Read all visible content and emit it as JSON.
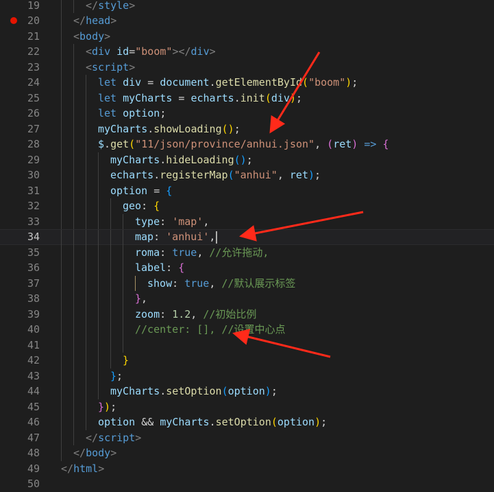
{
  "colors": {
    "background": "#1e1e1e",
    "line_number": "#858585",
    "tag": "#569cd6",
    "bracket_tag": "#808080",
    "attr": "#9cdcfe",
    "string": "#ce9178",
    "keyword": "#569cd6",
    "variable": "#9cdcfe",
    "function": "#dcdcaa",
    "number": "#b5cea8",
    "comment": "#6a9955",
    "punct": "#d4d4d4",
    "bracket1": "#ffd700",
    "bracket2": "#da70d6",
    "bracket3": "#179fff",
    "breakpoint": "#e51400",
    "arrow": "#ff2a1a"
  },
  "editor": {
    "current_line": 34,
    "breakpoint_line": 20,
    "lines": [
      {
        "n": 19,
        "indent": 1,
        "tokens": [
          [
            "</",
            "bracket_tag"
          ],
          [
            "style",
            "tag"
          ],
          [
            ">",
            "bracket_tag"
          ]
        ]
      },
      {
        "n": 20,
        "indent": 0,
        "tokens": [
          [
            "</",
            "bracket_tag"
          ],
          [
            "head",
            "tag"
          ],
          [
            ">",
            "bracket_tag"
          ]
        ]
      },
      {
        "n": 21,
        "indent": 0,
        "tokens": [
          [
            "<",
            "bracket_tag"
          ],
          [
            "body",
            "tag"
          ],
          [
            ">",
            "bracket_tag"
          ]
        ]
      },
      {
        "n": 22,
        "indent": 1,
        "tokens": [
          [
            "<",
            "bracket_tag"
          ],
          [
            "div",
            "tag"
          ],
          [
            " ",
            "punct"
          ],
          [
            "id",
            "attr"
          ],
          [
            "=",
            "punct"
          ],
          [
            "\"boom\"",
            "string"
          ],
          [
            "></",
            "bracket_tag"
          ],
          [
            "div",
            "tag"
          ],
          [
            ">",
            "bracket_tag"
          ]
        ]
      },
      {
        "n": 23,
        "indent": 1,
        "tokens": [
          [
            "<",
            "bracket_tag"
          ],
          [
            "script",
            "tag"
          ],
          [
            ">",
            "bracket_tag"
          ]
        ]
      },
      {
        "n": 24,
        "indent": 2,
        "tokens": [
          [
            "let",
            "keyword"
          ],
          [
            " ",
            "punct"
          ],
          [
            "div",
            "variable"
          ],
          [
            " = ",
            "punct"
          ],
          [
            "document",
            "variable"
          ],
          [
            ".",
            "punct"
          ],
          [
            "getElementById",
            "function"
          ],
          [
            "(",
            "bracket1"
          ],
          [
            "\"boom\"",
            "string"
          ],
          [
            ")",
            "bracket1"
          ],
          [
            ";",
            "punct"
          ]
        ]
      },
      {
        "n": 25,
        "indent": 2,
        "tokens": [
          [
            "let",
            "keyword"
          ],
          [
            " ",
            "punct"
          ],
          [
            "myCharts",
            "variable"
          ],
          [
            " = ",
            "punct"
          ],
          [
            "echarts",
            "variable"
          ],
          [
            ".",
            "punct"
          ],
          [
            "init",
            "function"
          ],
          [
            "(",
            "bracket1"
          ],
          [
            "div",
            "variable"
          ],
          [
            ")",
            "bracket1"
          ],
          [
            ";",
            "punct"
          ]
        ]
      },
      {
        "n": 26,
        "indent": 2,
        "tokens": [
          [
            "let",
            "keyword"
          ],
          [
            " ",
            "punct"
          ],
          [
            "option",
            "variable"
          ],
          [
            ";",
            "punct"
          ]
        ]
      },
      {
        "n": 27,
        "indent": 2,
        "tokens": [
          [
            "myCharts",
            "variable"
          ],
          [
            ".",
            "punct"
          ],
          [
            "showLoading",
            "function"
          ],
          [
            "()",
            "bracket1"
          ],
          [
            ";",
            "punct"
          ]
        ]
      },
      {
        "n": 28,
        "indent": 2,
        "tokens": [
          [
            "$",
            "variable"
          ],
          [
            ".",
            "punct"
          ],
          [
            "get",
            "function"
          ],
          [
            "(",
            "bracket1"
          ],
          [
            "\"11/json/province/anhui.json\"",
            "string"
          ],
          [
            ", ",
            "punct"
          ],
          [
            "(",
            "bracket2"
          ],
          [
            "ret",
            "variable"
          ],
          [
            ")",
            "bracket2"
          ],
          [
            " ",
            "punct"
          ],
          [
            "=>",
            "keyword"
          ],
          [
            " ",
            "punct"
          ],
          [
            "{",
            "bracket2"
          ]
        ]
      },
      {
        "n": 29,
        "indent": 3,
        "tokens": [
          [
            "myCharts",
            "variable"
          ],
          [
            ".",
            "punct"
          ],
          [
            "hideLoading",
            "function"
          ],
          [
            "()",
            "bracket3"
          ],
          [
            ";",
            "punct"
          ]
        ]
      },
      {
        "n": 30,
        "indent": 3,
        "tokens": [
          [
            "echarts",
            "variable"
          ],
          [
            ".",
            "punct"
          ],
          [
            "registerMap",
            "function"
          ],
          [
            "(",
            "bracket3"
          ],
          [
            "\"anhui\"",
            "string"
          ],
          [
            ", ",
            "punct"
          ],
          [
            "ret",
            "variable"
          ],
          [
            ")",
            "bracket3"
          ],
          [
            ";",
            "punct"
          ]
        ]
      },
      {
        "n": 31,
        "indent": 3,
        "tokens": [
          [
            "option",
            "variable"
          ],
          [
            " = ",
            "punct"
          ],
          [
            "{",
            "bracket3"
          ]
        ]
      },
      {
        "n": 32,
        "indent": 4,
        "tokens": [
          [
            "geo",
            "variable"
          ],
          [
            ": ",
            "punct"
          ],
          [
            "{",
            "bracket1"
          ]
        ]
      },
      {
        "n": 33,
        "indent": 5,
        "tokens": [
          [
            "type",
            "variable"
          ],
          [
            ": ",
            "punct"
          ],
          [
            "'map'",
            "string"
          ],
          [
            ",",
            "punct"
          ]
        ]
      },
      {
        "n": 34,
        "indent": 5,
        "tokens": [
          [
            "map",
            "variable"
          ],
          [
            ": ",
            "punct"
          ],
          [
            "'anhui'",
            "string"
          ],
          [
            ",",
            "punct"
          ]
        ]
      },
      {
        "n": 35,
        "indent": 5,
        "tokens": [
          [
            "roma",
            "variable"
          ],
          [
            ": ",
            "punct"
          ],
          [
            "true",
            "keyword"
          ],
          [
            ", ",
            "punct"
          ],
          [
            "//允许拖动,",
            "comment"
          ]
        ]
      },
      {
        "n": 36,
        "indent": 5,
        "tokens": [
          [
            "label",
            "variable"
          ],
          [
            ": ",
            "punct"
          ],
          [
            "{",
            "bracket2"
          ]
        ]
      },
      {
        "n": 37,
        "indent": 6,
        "tokens": [
          [
            "show",
            "variable"
          ],
          [
            ": ",
            "punct"
          ],
          [
            "true",
            "keyword"
          ],
          [
            ", ",
            "punct"
          ],
          [
            "//默认展示标签",
            "comment"
          ]
        ]
      },
      {
        "n": 38,
        "indent": 5,
        "tokens": [
          [
            "}",
            "bracket2"
          ],
          [
            ",",
            "punct"
          ]
        ]
      },
      {
        "n": 39,
        "indent": 5,
        "tokens": [
          [
            "zoom",
            "variable"
          ],
          [
            ": ",
            "punct"
          ],
          [
            "1.2",
            "number"
          ],
          [
            ", ",
            "punct"
          ],
          [
            "//初始比例",
            "comment"
          ]
        ]
      },
      {
        "n": 40,
        "indent": 5,
        "tokens": [
          [
            "//center: [], //设置中心点",
            "comment"
          ]
        ]
      },
      {
        "n": 41,
        "indent": 5,
        "tokens": []
      },
      {
        "n": 42,
        "indent": 4,
        "tokens": [
          [
            "}",
            "bracket1"
          ]
        ]
      },
      {
        "n": 43,
        "indent": 3,
        "tokens": [
          [
            "}",
            "bracket3"
          ],
          [
            ";",
            "punct"
          ]
        ]
      },
      {
        "n": 44,
        "indent": 3,
        "tokens": [
          [
            "myCharts",
            "variable"
          ],
          [
            ".",
            "punct"
          ],
          [
            "setOption",
            "function"
          ],
          [
            "(",
            "bracket3"
          ],
          [
            "option",
            "variable"
          ],
          [
            ")",
            "bracket3"
          ],
          [
            ";",
            "punct"
          ]
        ]
      },
      {
        "n": 45,
        "indent": 2,
        "tokens": [
          [
            "}",
            "bracket2"
          ],
          [
            ")",
            "bracket1"
          ],
          [
            ";",
            "punct"
          ]
        ]
      },
      {
        "n": 46,
        "indent": 2,
        "tokens": [
          [
            "option",
            "variable"
          ],
          [
            " && ",
            "punct"
          ],
          [
            "myCharts",
            "variable"
          ],
          [
            ".",
            "punct"
          ],
          [
            "setOption",
            "function"
          ],
          [
            "(",
            "bracket1"
          ],
          [
            "option",
            "variable"
          ],
          [
            ")",
            "bracket1"
          ],
          [
            ";",
            "punct"
          ]
        ]
      },
      {
        "n": 47,
        "indent": 1,
        "tokens": [
          [
            "</",
            "bracket_tag"
          ],
          [
            "script",
            "tag"
          ],
          [
            ">",
            "bracket_tag"
          ]
        ]
      },
      {
        "n": 48,
        "indent": 0,
        "tokens": [
          [
            "</",
            "bracket_tag"
          ],
          [
            "body",
            "tag"
          ],
          [
            ">",
            "bracket_tag"
          ]
        ]
      },
      {
        "n": 49,
        "indent": -1,
        "tokens": [
          [
            "</",
            "bracket_tag"
          ],
          [
            "html",
            "tag"
          ],
          [
            ">",
            "bracket_tag"
          ]
        ]
      },
      {
        "n": 50,
        "indent": -1,
        "tokens": []
      }
    ]
  }
}
